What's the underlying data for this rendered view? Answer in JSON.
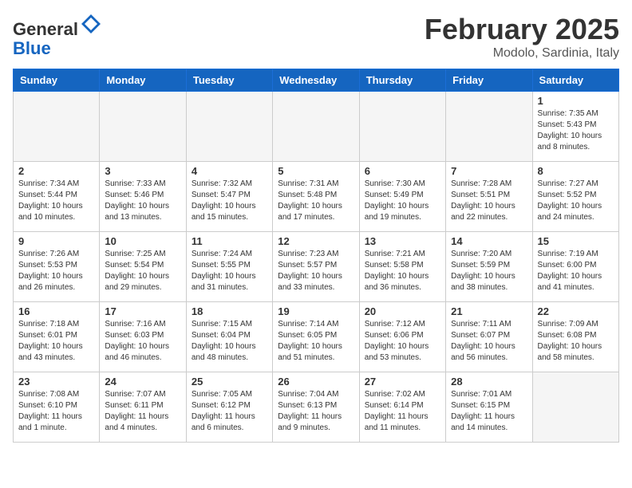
{
  "header": {
    "logo_general": "General",
    "logo_blue": "Blue",
    "title": "February 2025",
    "subtitle": "Modolo, Sardinia, Italy"
  },
  "days_of_week": [
    "Sunday",
    "Monday",
    "Tuesday",
    "Wednesday",
    "Thursday",
    "Friday",
    "Saturday"
  ],
  "weeks": [
    [
      {
        "day": "",
        "info": ""
      },
      {
        "day": "",
        "info": ""
      },
      {
        "day": "",
        "info": ""
      },
      {
        "day": "",
        "info": ""
      },
      {
        "day": "",
        "info": ""
      },
      {
        "day": "",
        "info": ""
      },
      {
        "day": "1",
        "info": "Sunrise: 7:35 AM\nSunset: 5:43 PM\nDaylight: 10 hours and 8 minutes."
      }
    ],
    [
      {
        "day": "2",
        "info": "Sunrise: 7:34 AM\nSunset: 5:44 PM\nDaylight: 10 hours and 10 minutes."
      },
      {
        "day": "3",
        "info": "Sunrise: 7:33 AM\nSunset: 5:46 PM\nDaylight: 10 hours and 13 minutes."
      },
      {
        "day": "4",
        "info": "Sunrise: 7:32 AM\nSunset: 5:47 PM\nDaylight: 10 hours and 15 minutes."
      },
      {
        "day": "5",
        "info": "Sunrise: 7:31 AM\nSunset: 5:48 PM\nDaylight: 10 hours and 17 minutes."
      },
      {
        "day": "6",
        "info": "Sunrise: 7:30 AM\nSunset: 5:49 PM\nDaylight: 10 hours and 19 minutes."
      },
      {
        "day": "7",
        "info": "Sunrise: 7:28 AM\nSunset: 5:51 PM\nDaylight: 10 hours and 22 minutes."
      },
      {
        "day": "8",
        "info": "Sunrise: 7:27 AM\nSunset: 5:52 PM\nDaylight: 10 hours and 24 minutes."
      }
    ],
    [
      {
        "day": "9",
        "info": "Sunrise: 7:26 AM\nSunset: 5:53 PM\nDaylight: 10 hours and 26 minutes."
      },
      {
        "day": "10",
        "info": "Sunrise: 7:25 AM\nSunset: 5:54 PM\nDaylight: 10 hours and 29 minutes."
      },
      {
        "day": "11",
        "info": "Sunrise: 7:24 AM\nSunset: 5:55 PM\nDaylight: 10 hours and 31 minutes."
      },
      {
        "day": "12",
        "info": "Sunrise: 7:23 AM\nSunset: 5:57 PM\nDaylight: 10 hours and 33 minutes."
      },
      {
        "day": "13",
        "info": "Sunrise: 7:21 AM\nSunset: 5:58 PM\nDaylight: 10 hours and 36 minutes."
      },
      {
        "day": "14",
        "info": "Sunrise: 7:20 AM\nSunset: 5:59 PM\nDaylight: 10 hours and 38 minutes."
      },
      {
        "day": "15",
        "info": "Sunrise: 7:19 AM\nSunset: 6:00 PM\nDaylight: 10 hours and 41 minutes."
      }
    ],
    [
      {
        "day": "16",
        "info": "Sunrise: 7:18 AM\nSunset: 6:01 PM\nDaylight: 10 hours and 43 minutes."
      },
      {
        "day": "17",
        "info": "Sunrise: 7:16 AM\nSunset: 6:03 PM\nDaylight: 10 hours and 46 minutes."
      },
      {
        "day": "18",
        "info": "Sunrise: 7:15 AM\nSunset: 6:04 PM\nDaylight: 10 hours and 48 minutes."
      },
      {
        "day": "19",
        "info": "Sunrise: 7:14 AM\nSunset: 6:05 PM\nDaylight: 10 hours and 51 minutes."
      },
      {
        "day": "20",
        "info": "Sunrise: 7:12 AM\nSunset: 6:06 PM\nDaylight: 10 hours and 53 minutes."
      },
      {
        "day": "21",
        "info": "Sunrise: 7:11 AM\nSunset: 6:07 PM\nDaylight: 10 hours and 56 minutes."
      },
      {
        "day": "22",
        "info": "Sunrise: 7:09 AM\nSunset: 6:08 PM\nDaylight: 10 hours and 58 minutes."
      }
    ],
    [
      {
        "day": "23",
        "info": "Sunrise: 7:08 AM\nSunset: 6:10 PM\nDaylight: 11 hours and 1 minute."
      },
      {
        "day": "24",
        "info": "Sunrise: 7:07 AM\nSunset: 6:11 PM\nDaylight: 11 hours and 4 minutes."
      },
      {
        "day": "25",
        "info": "Sunrise: 7:05 AM\nSunset: 6:12 PM\nDaylight: 11 hours and 6 minutes."
      },
      {
        "day": "26",
        "info": "Sunrise: 7:04 AM\nSunset: 6:13 PM\nDaylight: 11 hours and 9 minutes."
      },
      {
        "day": "27",
        "info": "Sunrise: 7:02 AM\nSunset: 6:14 PM\nDaylight: 11 hours and 11 minutes."
      },
      {
        "day": "28",
        "info": "Sunrise: 7:01 AM\nSunset: 6:15 PM\nDaylight: 11 hours and 14 minutes."
      },
      {
        "day": "",
        "info": ""
      }
    ]
  ]
}
